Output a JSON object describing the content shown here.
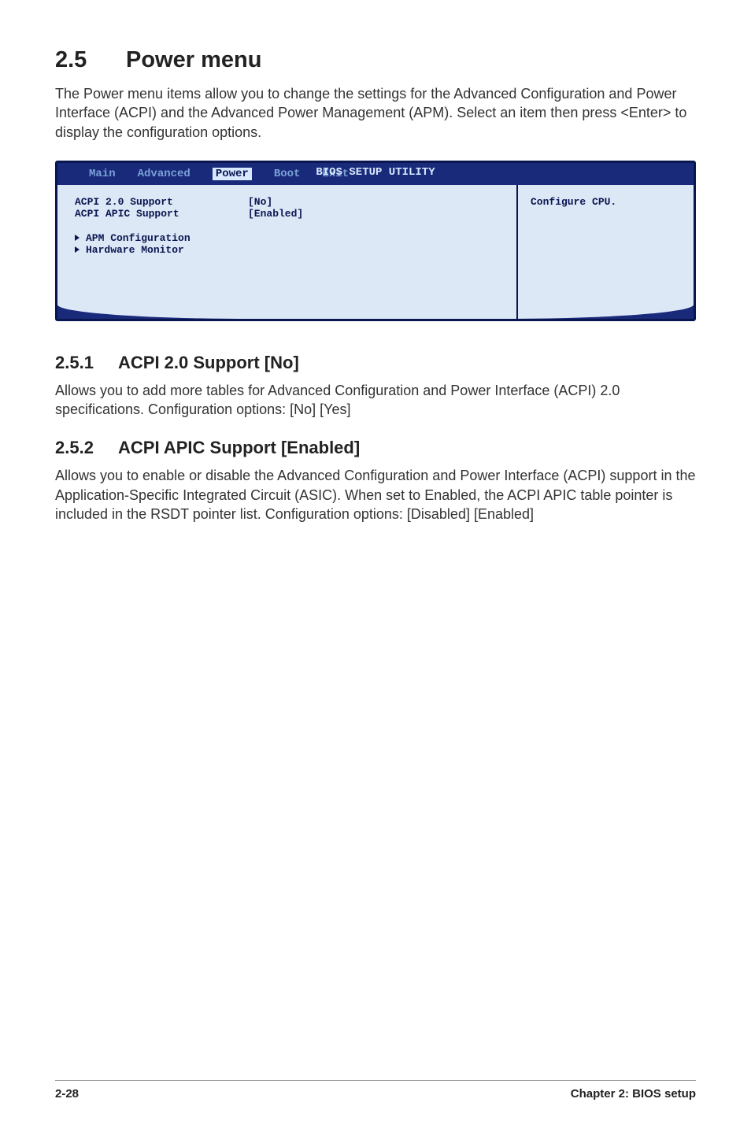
{
  "section": {
    "number": "2.5",
    "title": "Power menu",
    "intro": "The Power menu items allow you to change the settings for the Advanced Configuration and Power Interface (ACPI) and the Advanced Power Management (APM). Select an item then press <Enter> to display the configuration options."
  },
  "bios": {
    "utility_title": "BIOS SETUP UTILITY",
    "tabs": {
      "main": "Main",
      "advanced": "Advanced",
      "power": "Power",
      "boot": "Boot",
      "exit": "Exit"
    },
    "items": [
      {
        "label": "ACPI 2.0 Support",
        "value": "[No]"
      },
      {
        "label": "ACPI APIC Support",
        "value": "[Enabled]"
      }
    ],
    "submenus": [
      "APM Configuration",
      "Hardware Monitor"
    ],
    "help": "Configure CPU."
  },
  "sub1": {
    "number": "2.5.1",
    "title": "ACPI 2.0 Support [No]",
    "body": "Allows you to add more tables for Advanced Configuration and Power Interface (ACPI) 2.0 specifications. Configuration options: [No] [Yes]"
  },
  "sub2": {
    "number": "2.5.2",
    "title": "ACPI APIC Support [Enabled]",
    "body": "Allows you to enable or disable the Advanced Configuration and Power Interface (ACPI) support in the Application-Specific Integrated Circuit (ASIC). When set to Enabled, the ACPI APIC table pointer is included in the RSDT pointer list. Configuration options: [Disabled] [Enabled]"
  },
  "footer": {
    "page": "2-28",
    "chapter": "Chapter 2: BIOS setup"
  }
}
